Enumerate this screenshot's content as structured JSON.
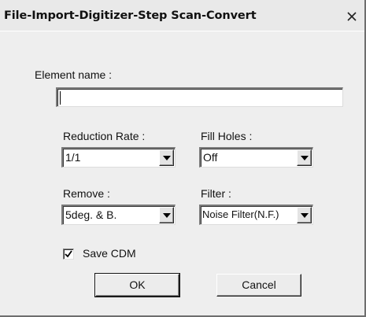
{
  "dialog": {
    "title": "File-Import-Digitizer-Step Scan-Convert",
    "close_glyph": "X"
  },
  "element_name": {
    "label": "Element name :",
    "value": ""
  },
  "reduction_rate": {
    "label": "Reduction Rate :",
    "value": "1/1"
  },
  "fill_holes": {
    "label": "Fill Holes :",
    "value": "Off"
  },
  "remove": {
    "label": "Remove :",
    "value": "5deg. & B."
  },
  "filter": {
    "label": "Filter :",
    "value": "Noise Filter(N.F.)"
  },
  "save_cdm": {
    "label": "Save CDM",
    "checked": true
  },
  "buttons": {
    "ok": "OK",
    "cancel": "Cancel"
  },
  "icons": {
    "close": "close-icon",
    "dropdown": "dropdown-arrow-icon",
    "check": "checkmark-icon"
  }
}
